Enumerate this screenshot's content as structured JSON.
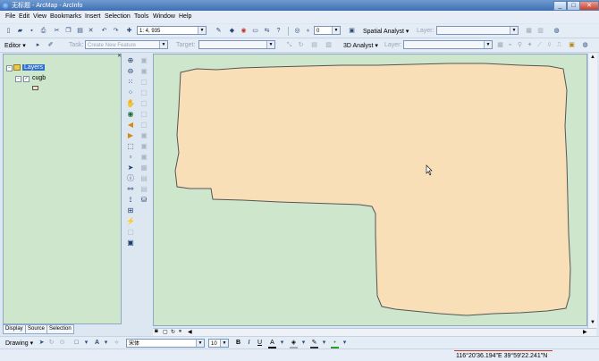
{
  "window": {
    "title": "无标题 - ArcMap - ArcInfo",
    "minimize": "_",
    "maximize": "□",
    "close": "✕"
  },
  "menu": [
    "File",
    "Edit",
    "View",
    "Bookmarks",
    "Insert",
    "Selection",
    "Tools",
    "Window",
    "Help"
  ],
  "standard_toolbar": {
    "scale_value": "1: 4, 935",
    "layer_level_value": "0",
    "spatial_analyst_label": "Spatial Analyst ▾",
    "layer_label": "Layer:"
  },
  "editor_toolbar": {
    "editor_label": "Editor ▾",
    "task_label": "Task:",
    "task_value": "Create New Feature",
    "target_label": "Target:",
    "analyst3d_label": "3D Analyst ▾",
    "layer_label": "Layer:"
  },
  "toc": {
    "root_label": "Layers",
    "layer_name": "cugb",
    "symbol_color": "#f9dfb8",
    "tabs": [
      "Display",
      "Source",
      "Selection"
    ]
  },
  "map": {
    "background_color": "#cde6cc",
    "polygon_fill": "#f9dfb8",
    "polygon_stroke": "#555555"
  },
  "drawing_toolbar": {
    "drawing_label": "Drawing ▾",
    "font_name": "宋体",
    "font_size": "10",
    "bold": "B",
    "italic": "I",
    "underline": "U",
    "font_color_icon": "A"
  },
  "status": {
    "coordinates": "116°20'36.194\"E  39°59'22.241\"N"
  },
  "icons": {
    "app": "arcmap-globe-icon",
    "new": "new-doc-icon",
    "open": "open-folder-icon",
    "save": "save-disk-icon",
    "print": "printer-icon",
    "zoom_in": "zoom-in-icon",
    "zoom_out": "zoom-out-icon",
    "pan": "pan-hand-icon",
    "full_extent": "globe-icon",
    "select": "arrow-cursor-icon",
    "identify": "info-icon",
    "find": "binoculars-icon"
  }
}
